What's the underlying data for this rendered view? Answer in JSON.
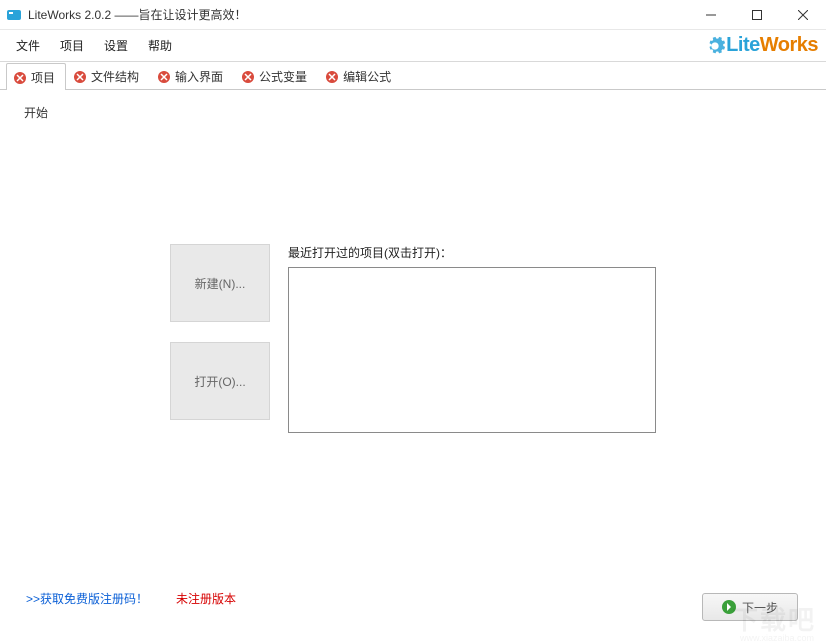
{
  "window": {
    "title": "LiteWorks 2.0.2 ——旨在让设计更高效！"
  },
  "menu": {
    "items": [
      "文件",
      "项目",
      "设置",
      "帮助"
    ]
  },
  "logo": {
    "part1": "Lite",
    "part2": "Works"
  },
  "tabs": [
    {
      "label": "项目",
      "kind": "close"
    },
    {
      "label": "文件结构",
      "kind": "error"
    },
    {
      "label": "输入界面",
      "kind": "error"
    },
    {
      "label": "公式变量",
      "kind": "error"
    },
    {
      "label": "编辑公式",
      "kind": "error"
    }
  ],
  "content": {
    "section_label": "开始",
    "new_btn": "新建(N)...",
    "open_btn": "打开(O)...",
    "recent_label": "最近打开过的项目(双击打开)："
  },
  "footer": {
    "get_code": ">>获取免费版注册码！",
    "unregistered": "未注册版本",
    "next": "下一步"
  },
  "watermark": {
    "main": "下载吧",
    "sub": "www.xiazaiba.com"
  }
}
